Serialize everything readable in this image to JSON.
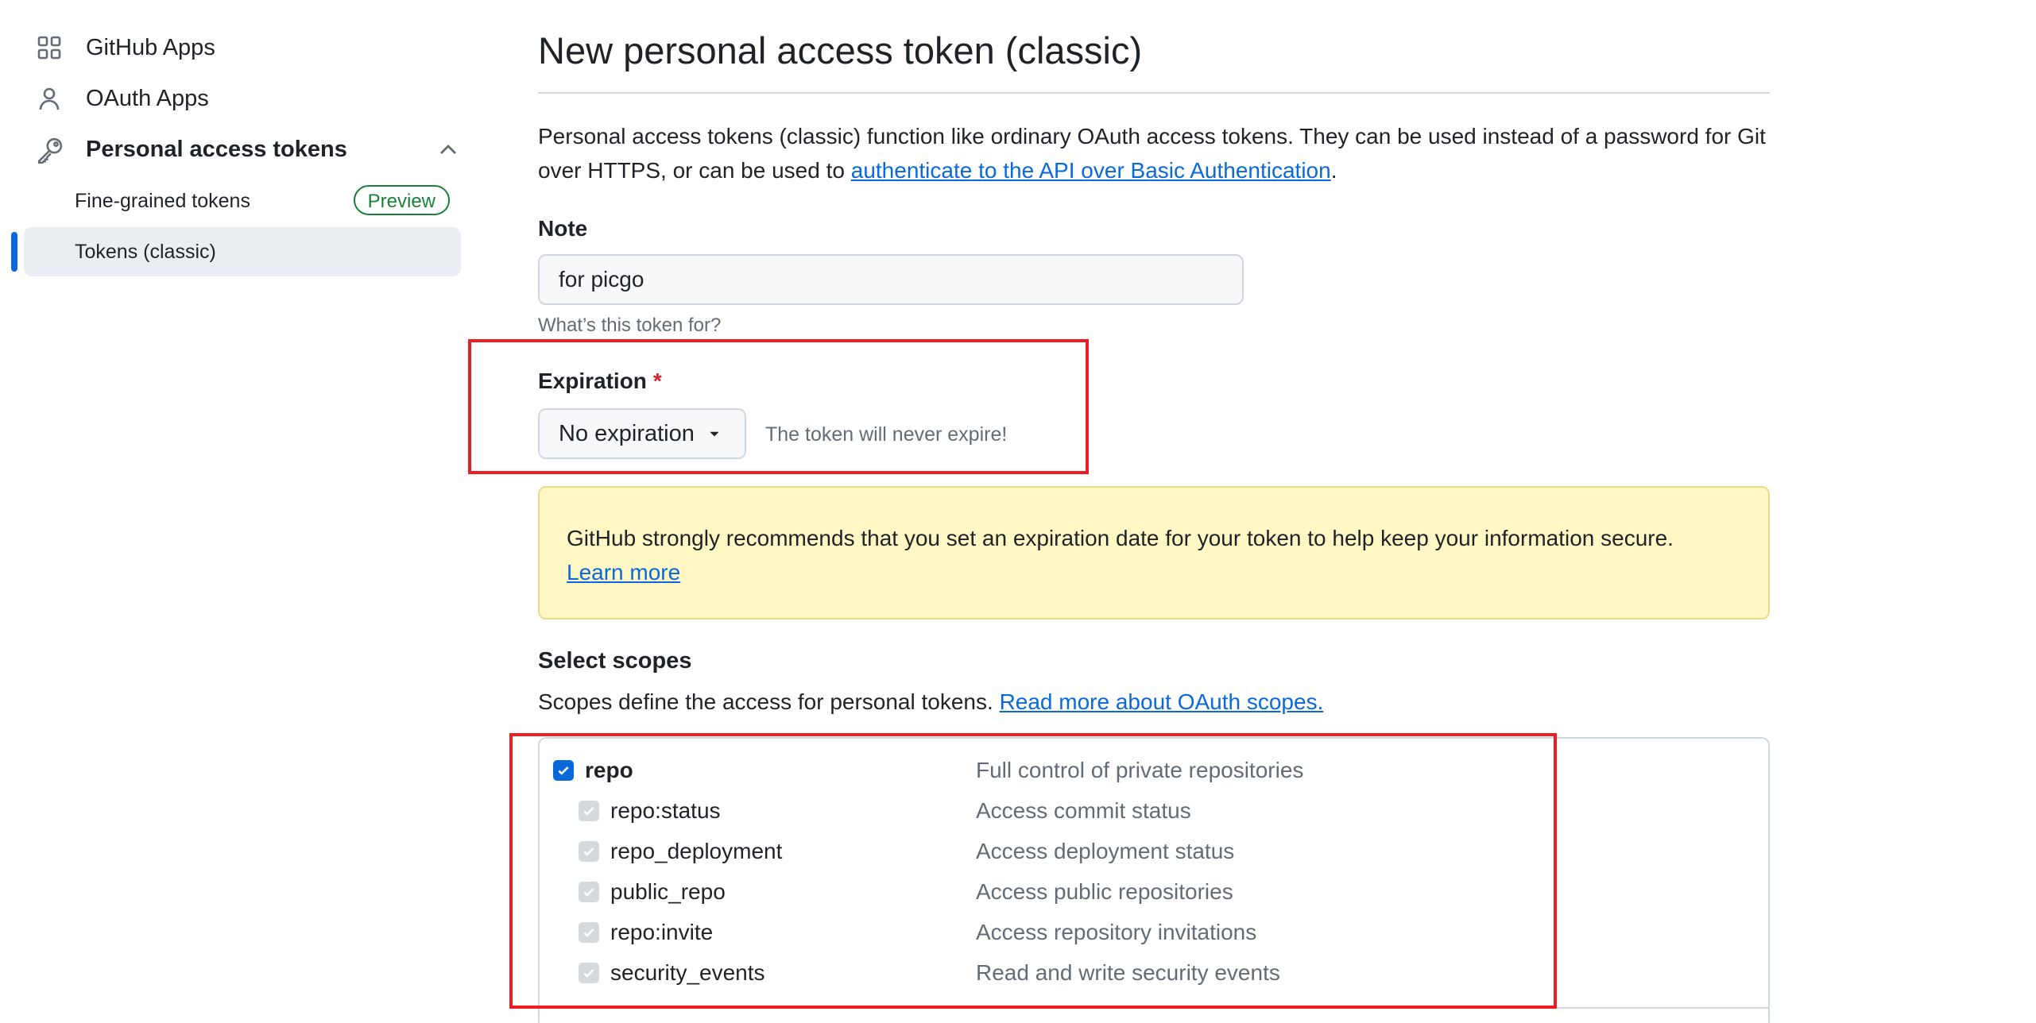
{
  "sidebar": {
    "items": [
      {
        "label": "GitHub Apps",
        "icon": "apps-grid-icon"
      },
      {
        "label": "OAuth Apps",
        "icon": "person-icon"
      },
      {
        "label": "Personal access tokens",
        "icon": "key-icon",
        "expanded": true
      }
    ],
    "sub_items": [
      {
        "label": "Fine-grained tokens",
        "badge": "Preview"
      },
      {
        "label": "Tokens (classic)",
        "active": true
      }
    ]
  },
  "main": {
    "title": "New personal access token (classic)",
    "intro_text": "Personal access tokens (classic) function like ordinary OAuth access tokens. They can be used instead of a password for Git over HTTPS, or can be used to ",
    "intro_link": "authenticate to the API over Basic Authentication",
    "intro_end": ".",
    "note": {
      "label": "Note",
      "value": "for picgo",
      "hint": "What’s this token for?"
    },
    "expiration": {
      "label": "Expiration",
      "required_mark": "*",
      "selected": "No expiration",
      "note": "The token will never expire!"
    },
    "warning": {
      "text": "GitHub strongly recommends that you set an expiration date for your token to help keep your information secure. ",
      "link": "Learn more"
    },
    "scopes": {
      "title": "Select scopes",
      "description": "Scopes define the access for personal tokens. ",
      "link": "Read more about OAuth scopes.",
      "items": [
        {
          "name": "repo",
          "description": "Full control of private repositories",
          "checked": true,
          "parent": true
        },
        {
          "name": "repo:status",
          "description": "Access commit status",
          "checked": true
        },
        {
          "name": "repo_deployment",
          "description": "Access deployment status",
          "checked": true
        },
        {
          "name": "public_repo",
          "description": "Access public repositories",
          "checked": true
        },
        {
          "name": "repo:invite",
          "description": "Access repository invitations",
          "checked": true
        },
        {
          "name": "security_events",
          "description": "Read and write security events",
          "checked": true
        }
      ]
    }
  },
  "colors": {
    "accent": "#0969da",
    "success": "#1a7f37",
    "warning_bg": "#fff8c5",
    "annotation_red": "#ee1c25"
  }
}
